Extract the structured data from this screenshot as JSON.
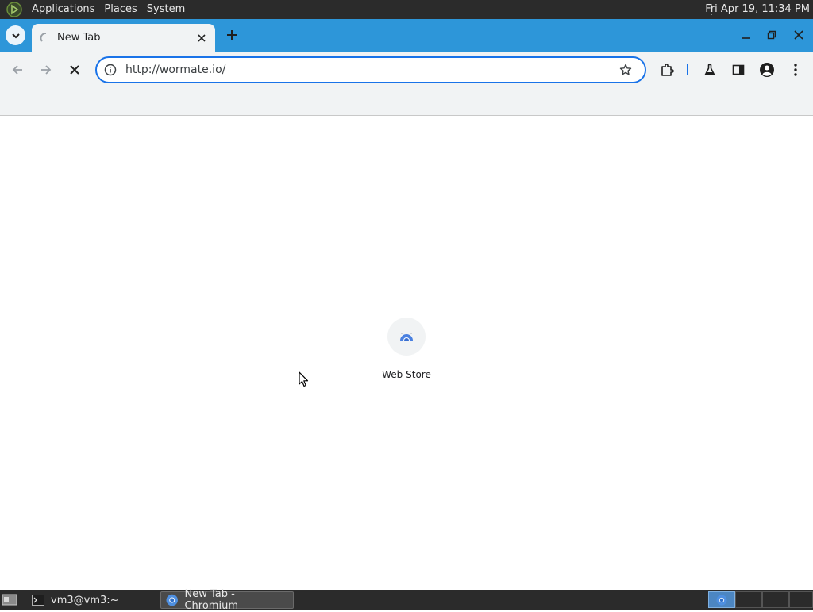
{
  "top_panel": {
    "menus": [
      "Applications",
      "Places",
      "System"
    ],
    "clock": "Fri Apr 19, 11:34 PM"
  },
  "browser": {
    "tab": {
      "title": "New Tab"
    },
    "address_bar": {
      "url": "http://wormate.io/"
    }
  },
  "page": {
    "shortcuts": [
      {
        "label": "Web Store"
      }
    ]
  },
  "taskbar": {
    "tasks": [
      {
        "label": "vm3@vm3:~",
        "icon": "terminal-icon"
      },
      {
        "label": "New Tab - Chromium",
        "icon": "chromium-icon"
      }
    ]
  },
  "colors": {
    "tabstrip": "#2d96d9",
    "toolbar": "#f1f3f4",
    "focus_ring": "#1a73e8",
    "panel": "#2b2b2b"
  }
}
